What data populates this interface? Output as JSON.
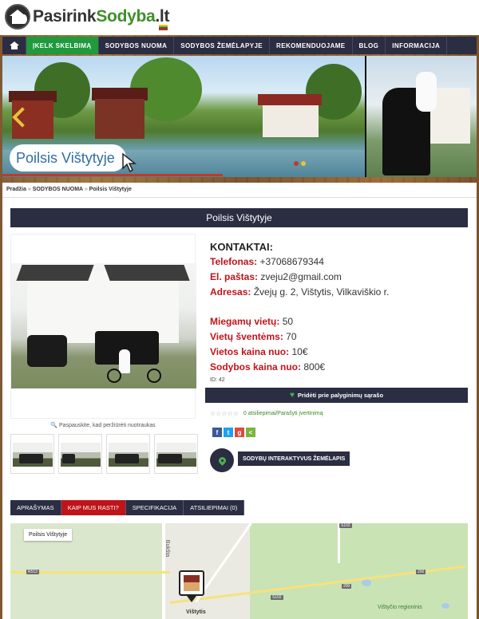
{
  "site": {
    "logo": {
      "part1": "Pasirink",
      "part2": "Sodyba",
      "part3": ".lt"
    }
  },
  "nav": {
    "items": [
      {
        "label": "ĮKELK SKELBIMĄ",
        "active": true
      },
      {
        "label": "SODYBOS NUOMA"
      },
      {
        "label": "SODYBOS ŽEMĖLAPYJE"
      },
      {
        "label": "REKOMENDUOJAME"
      },
      {
        "label": "BLOG"
      },
      {
        "label": "INFORMACIJA"
      }
    ]
  },
  "slider": {
    "caption": "Poilsis Vištytyje"
  },
  "breadcrumb": {
    "home": "Pradžia",
    "sep1": "»",
    "section": "SODYBOS NUOMA",
    "sep2": "»",
    "current": "Poilsis Vištytyje"
  },
  "listing": {
    "title": "Poilsis Vištytyje",
    "zoom_hint": "Paspauskite, kad peržiūrėti nuotraukas",
    "contacts_heading": "KONTAKTAI:",
    "phone_label": "Telefonas:",
    "phone": "+37068679344",
    "email_label": "El. paštas:",
    "email": "zveju2@gmail.com",
    "address_label": "Adresas:",
    "address": "Žvejų g. 2, Vištytis, Vilkaviškio r.",
    "beds_label": "Miegamų vietų:",
    "beds": "50",
    "event_label": "Vietų šventėms:",
    "event_places": "70",
    "price_place_label": "Vietos kaina nuo:",
    "price_place": "10€",
    "price_house_label": "Sodybos kaina nuo:",
    "price_house": "800€",
    "id_text": "ID: 42",
    "compare_button": "Pridėti prie palyginimų sąrašo",
    "stars": "☆☆☆☆☆",
    "reviews_link": "0 atsiliepimai",
    "rating_sep": " / ",
    "write_review": "Parašyti įvertinimą",
    "map_button": "SODYBŲ INTERAKTYVUS ŽEMĖLAPIS"
  },
  "tabs": [
    {
      "label": "APRAŠYMAS"
    },
    {
      "label": "KAIP MUS RASTI?",
      "active": true
    },
    {
      "label": "SPECIFIKACIJA"
    },
    {
      "label": "ATSILIEPIMAI (0)"
    }
  ],
  "map": {
    "label": "Poilsis Vištytyje",
    "road1": "R513",
    "road2": "S102",
    "road3": "S102",
    "road4": "200",
    "road5": "200",
    "town": "Vištytis",
    "park": "Vištyčio regioninis",
    "place": "Bukšta"
  },
  "colors": {
    "nav_bg": "#2b2d42",
    "active_green": "#1f9a3c",
    "accent_red": "#c0141a",
    "link_green": "#3a8a2a"
  }
}
